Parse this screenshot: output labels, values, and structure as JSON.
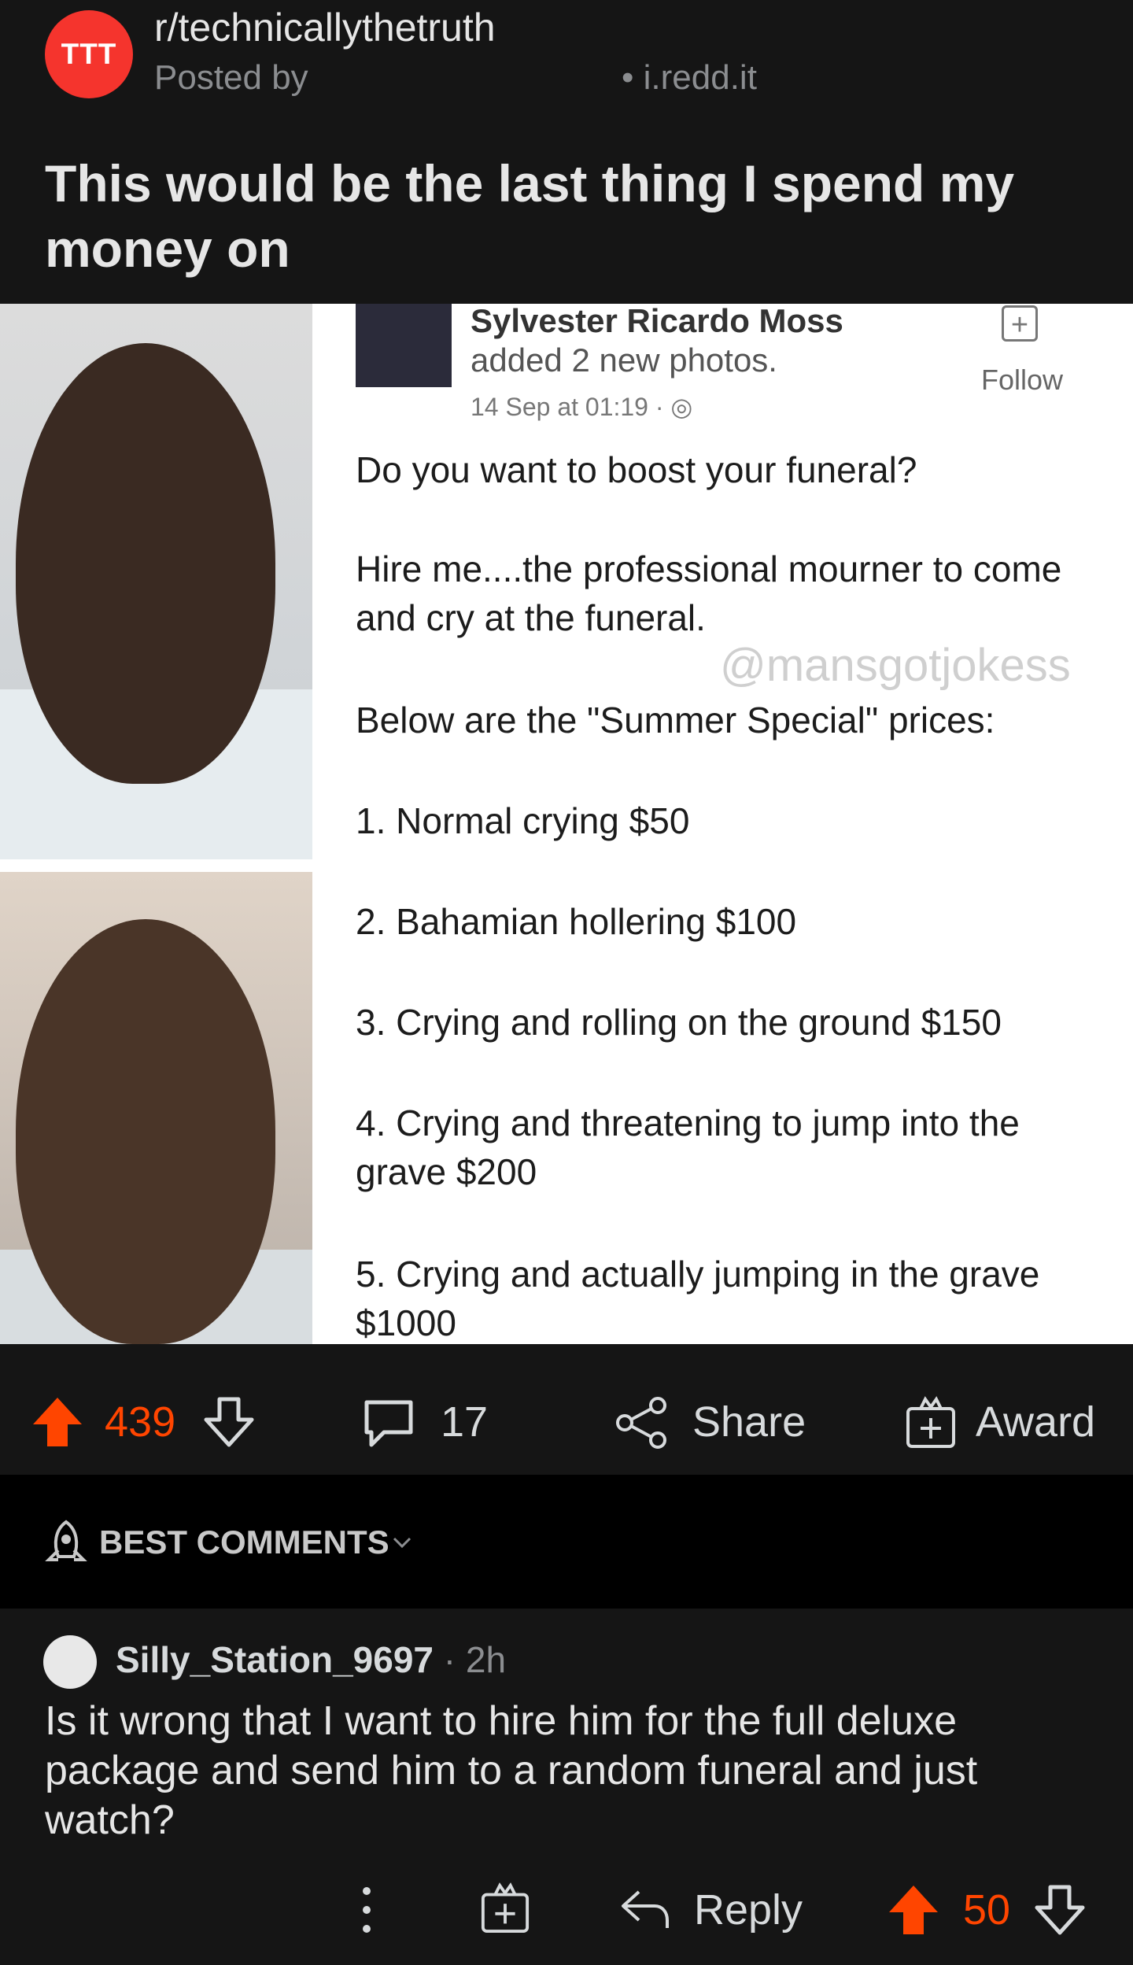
{
  "post": {
    "subreddit": "r/technicallythetruth",
    "avatar_text": "TTT",
    "posted_by": "Posted by",
    "domain": "• i.redd.it",
    "title": "This would be the last thing I spend my money on"
  },
  "image": {
    "fb_name": "Sylvester Ricardo Moss",
    "fb_added": "added 2 new photos.",
    "fb_time": "14 Sep at 01:19 · ",
    "fb_follow": "Follow",
    "line1": "Do you want to boost your funeral?",
    "line2a": "Hire me....the professional mourner to come",
    "line2b": "and cry at the funeral.",
    "watermark": "@mansgotjokess",
    "line3": "Below are the \"Summer Special\"  prices:",
    "item1": "1. Normal crying $50",
    "item2": "2. Bahamian hollering $100",
    "item3": "3. Crying and rolling on the ground $150",
    "item4a": "4. Crying and threatening to jump into the",
    "item4b": "grave $200",
    "item5a": "5. Crying and actually jumping in the grave",
    "item5b": "$1000"
  },
  "actions": {
    "upvotes": "439",
    "comments": "17",
    "share": "Share",
    "award": "Award"
  },
  "sort": {
    "label": "BEST COMMENTS"
  },
  "comment": {
    "username": "Silly_Station_9697",
    "time": "· 2h",
    "body": "Is it wrong that I want to hire him for the full deluxe package and send him to a random funeral and just watch?",
    "reply": "Reply",
    "votes": "50"
  },
  "colors": {
    "upvote": "#ff4500",
    "subreddit_avatar": "#f5342d"
  }
}
